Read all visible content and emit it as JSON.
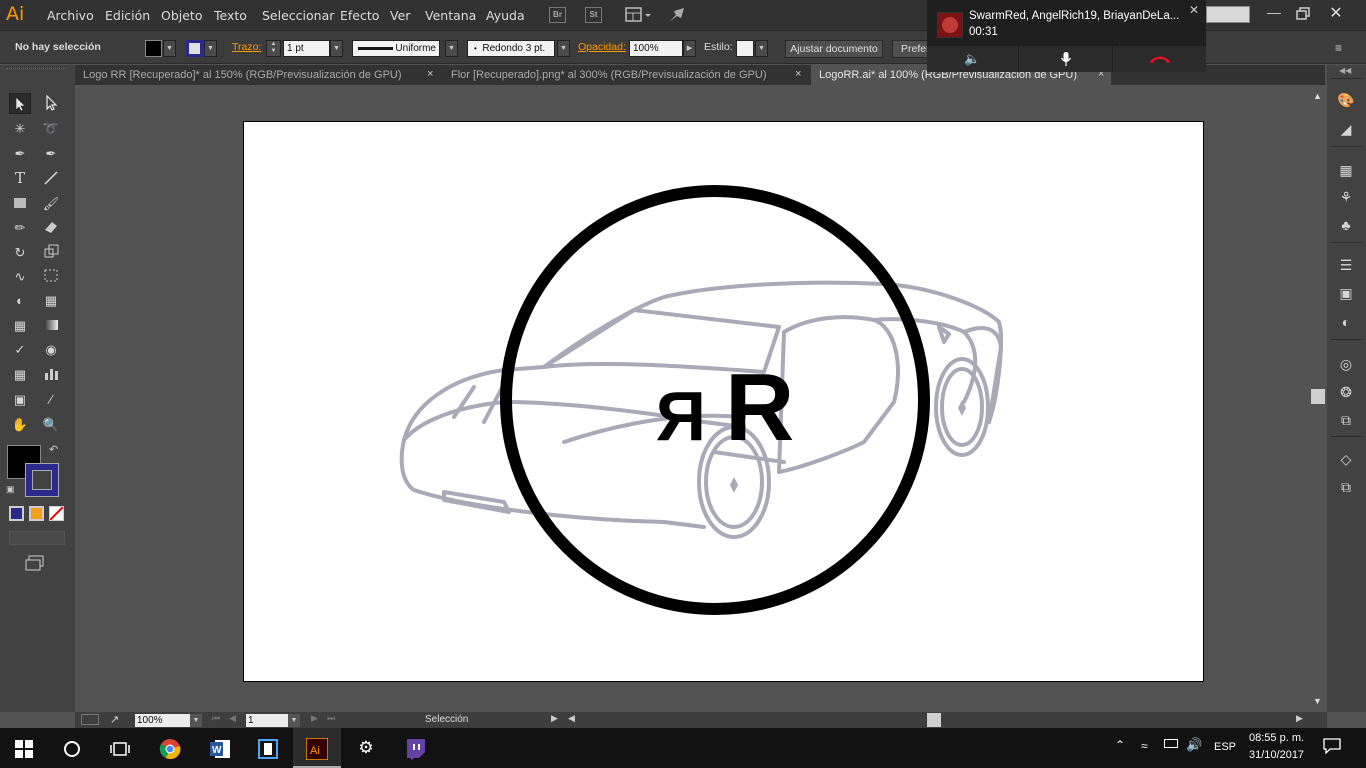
{
  "app": {
    "logo": "Ai"
  },
  "menubar": {
    "items": [
      "Archivo",
      "Edición",
      "Objeto",
      "Texto",
      "Seleccionar",
      "Efecto",
      "Ver",
      "Ventana",
      "Ayuda"
    ],
    "bridge_btn": "Br",
    "stock_btn": "St"
  },
  "control_bar": {
    "selection_status": "No hay selección",
    "stroke_label": "Trazo:",
    "stroke_weight": "1 pt",
    "stroke_profile": "Uniforme",
    "brush": "Redondo 3 pt.",
    "opacity_label": "Opacidad:",
    "opacity_value": "100%",
    "style_label": "Estilo:",
    "fit_document_button": "Ajustar documento",
    "preferences_button": "Prefer",
    "accent_color": "#ff9a00"
  },
  "tabs": [
    {
      "label": "Logo RR [Recuperado]* al 150% (RGB/Previsualización de GPU)",
      "active": false
    },
    {
      "label": "Flor [Recuperado].png* al 300% (RGB/Previsualización de GPU)",
      "active": false
    },
    {
      "label": "LogoRR.ai* al 100% (RGB/Previsualización de GPU)",
      "active": true
    }
  ],
  "tab_close_glyph": "×",
  "artwork": {
    "logo_text_mirrored": "R",
    "logo_text": "R"
  },
  "statusbar": {
    "zoom": "100%",
    "artboard_number": "1",
    "tool_name": "Selección"
  },
  "call": {
    "participants": "SwarmRed, AngelRich19, BriayanDeLa...",
    "duration": "00:31",
    "close_glyph": "✕"
  },
  "tray": {
    "language": "ESP",
    "time": "08:55 p. m.",
    "date": "31/10/2017"
  },
  "colors": {
    "fill_swatch": "#000000",
    "stroke_swatch": "#2b2a8c",
    "hangup": "#e81123",
    "twitch": "#6441a4",
    "illustrator_taskbar": "#ff9a00"
  }
}
